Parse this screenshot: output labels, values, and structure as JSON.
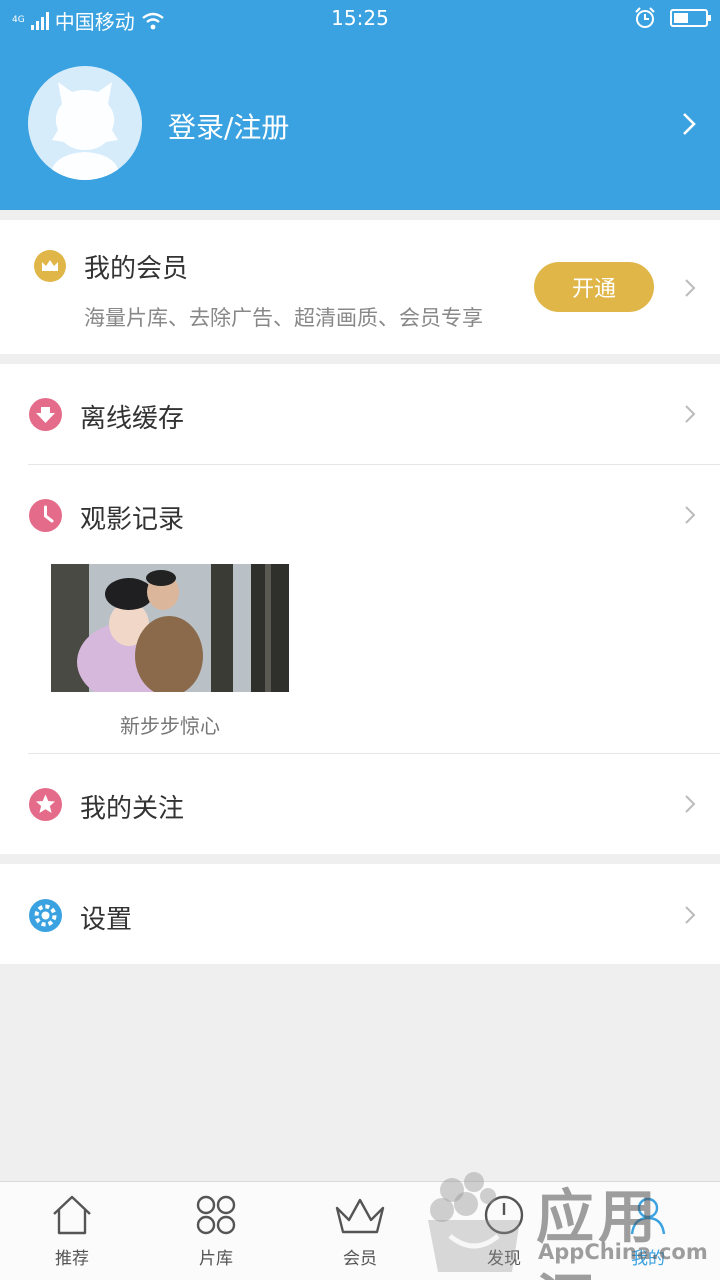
{
  "status_bar": {
    "network": "4G",
    "carrier": "中国移动",
    "time": "15:25",
    "battery_level": 0.45
  },
  "header": {
    "login_label": "登录/注册",
    "background_color": "#3aa2e0"
  },
  "vip": {
    "title": "我的会员",
    "subtitle": "海量片库、去除广告、超清画质、会员专享",
    "open_button": "开通",
    "accent_color": "#e0b649"
  },
  "menu": {
    "offline": "离线缓存",
    "history": "观影记录",
    "follow": "我的关注",
    "settings": "设置"
  },
  "history_items": [
    {
      "title": "新步步惊心"
    }
  ],
  "tabs": [
    {
      "label": "推荐",
      "icon": "home-icon"
    },
    {
      "label": "片库",
      "icon": "grid-icon"
    },
    {
      "label": "会员",
      "icon": "crown-icon"
    },
    {
      "label": "发现",
      "icon": "compass-icon"
    },
    {
      "label": "我的",
      "icon": "user-icon"
    }
  ],
  "watermark": {
    "text": "应用汇",
    "sub": "AppChina.com"
  }
}
